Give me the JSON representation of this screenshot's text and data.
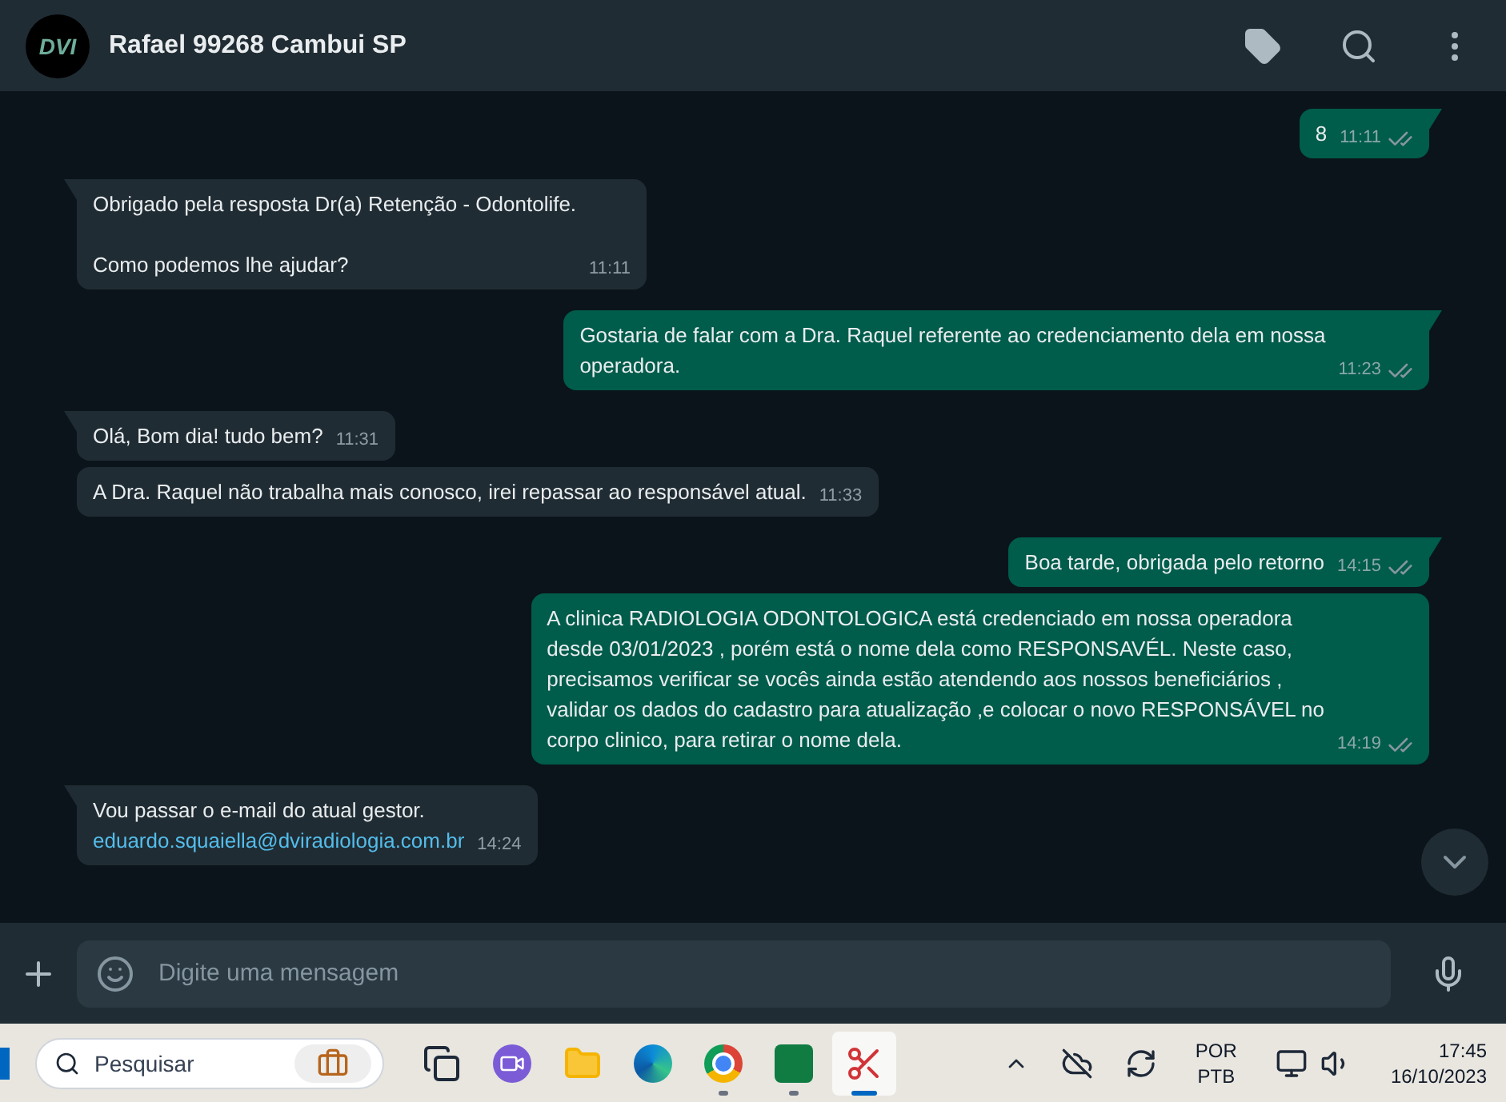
{
  "chat_header": {
    "title": "Rafael 99268 Cambui SP",
    "avatar_text": "DVI"
  },
  "messages": [
    {
      "kind": "outgoing",
      "tail": true,
      "text": "8",
      "time": "11:11",
      "read": true
    },
    {
      "kind": "incoming",
      "tail": true,
      "text": "Obrigado pela resposta Dr(a) Retenção - Odontolife.\n\nComo podemos lhe ajudar?",
      "time": "11:11"
    },
    {
      "kind": "outgoing",
      "tail": true,
      "text": "Gostaria de falar com a Dra. Raquel referente ao credenciamento dela em nossa\noperadora.",
      "time": "11:23",
      "read": true
    },
    {
      "kind": "incoming",
      "tail": true,
      "text": "Olá, Bom dia! tudo bem?",
      "time": "11:31"
    },
    {
      "kind": "incoming",
      "tail": false,
      "text": "A Dra. Raquel não trabalha mais conosco, irei repassar ao responsável atual.",
      "time": "11:33"
    },
    {
      "kind": "outgoing",
      "tail": true,
      "text": "Boa tarde, obrigada pelo retorno",
      "time": "14:15",
      "read": true
    },
    {
      "kind": "outgoing",
      "tail": false,
      "text": "A clinica RADIOLOGIA ODONTOLOGICA está credenciado em nossa operadora\ndesde 03/01/2023 , porém está o nome dela como RESPONSAVÉL. Neste caso,\nprecisamos verificar se vocês ainda estão atendendo aos nossos beneficiários ,\nvalidar os dados do cadastro para atualização ,e colocar o novo RESPONSÁVEL no\ncorpo clinico, para retirar o nome dela.",
      "time": "14:19",
      "read": true
    },
    {
      "kind": "incoming",
      "tail": true,
      "text": "Vou passar o e-mail do atual gestor.",
      "link": "eduardo.squaiella@dviradiologia.com.br",
      "time": "14:24"
    }
  ],
  "composer": {
    "placeholder": "Digite uma mensagem"
  },
  "taskbar": {
    "search_placeholder": "Pesquisar",
    "apps": [
      {
        "kind": "taskview",
        "running": false,
        "active": false
      },
      {
        "kind": "meet",
        "running": false,
        "active": false
      },
      {
        "kind": "folder",
        "running": false,
        "active": false
      },
      {
        "kind": "edge",
        "running": false,
        "active": false
      },
      {
        "kind": "chrome",
        "running": true,
        "active": false
      },
      {
        "kind": "excel",
        "running": true,
        "active": false
      },
      {
        "kind": "snip",
        "running": true,
        "active": true
      }
    ],
    "language": "POR",
    "layout": "PTB",
    "time": "17:45",
    "date": "16/10/2023"
  }
}
